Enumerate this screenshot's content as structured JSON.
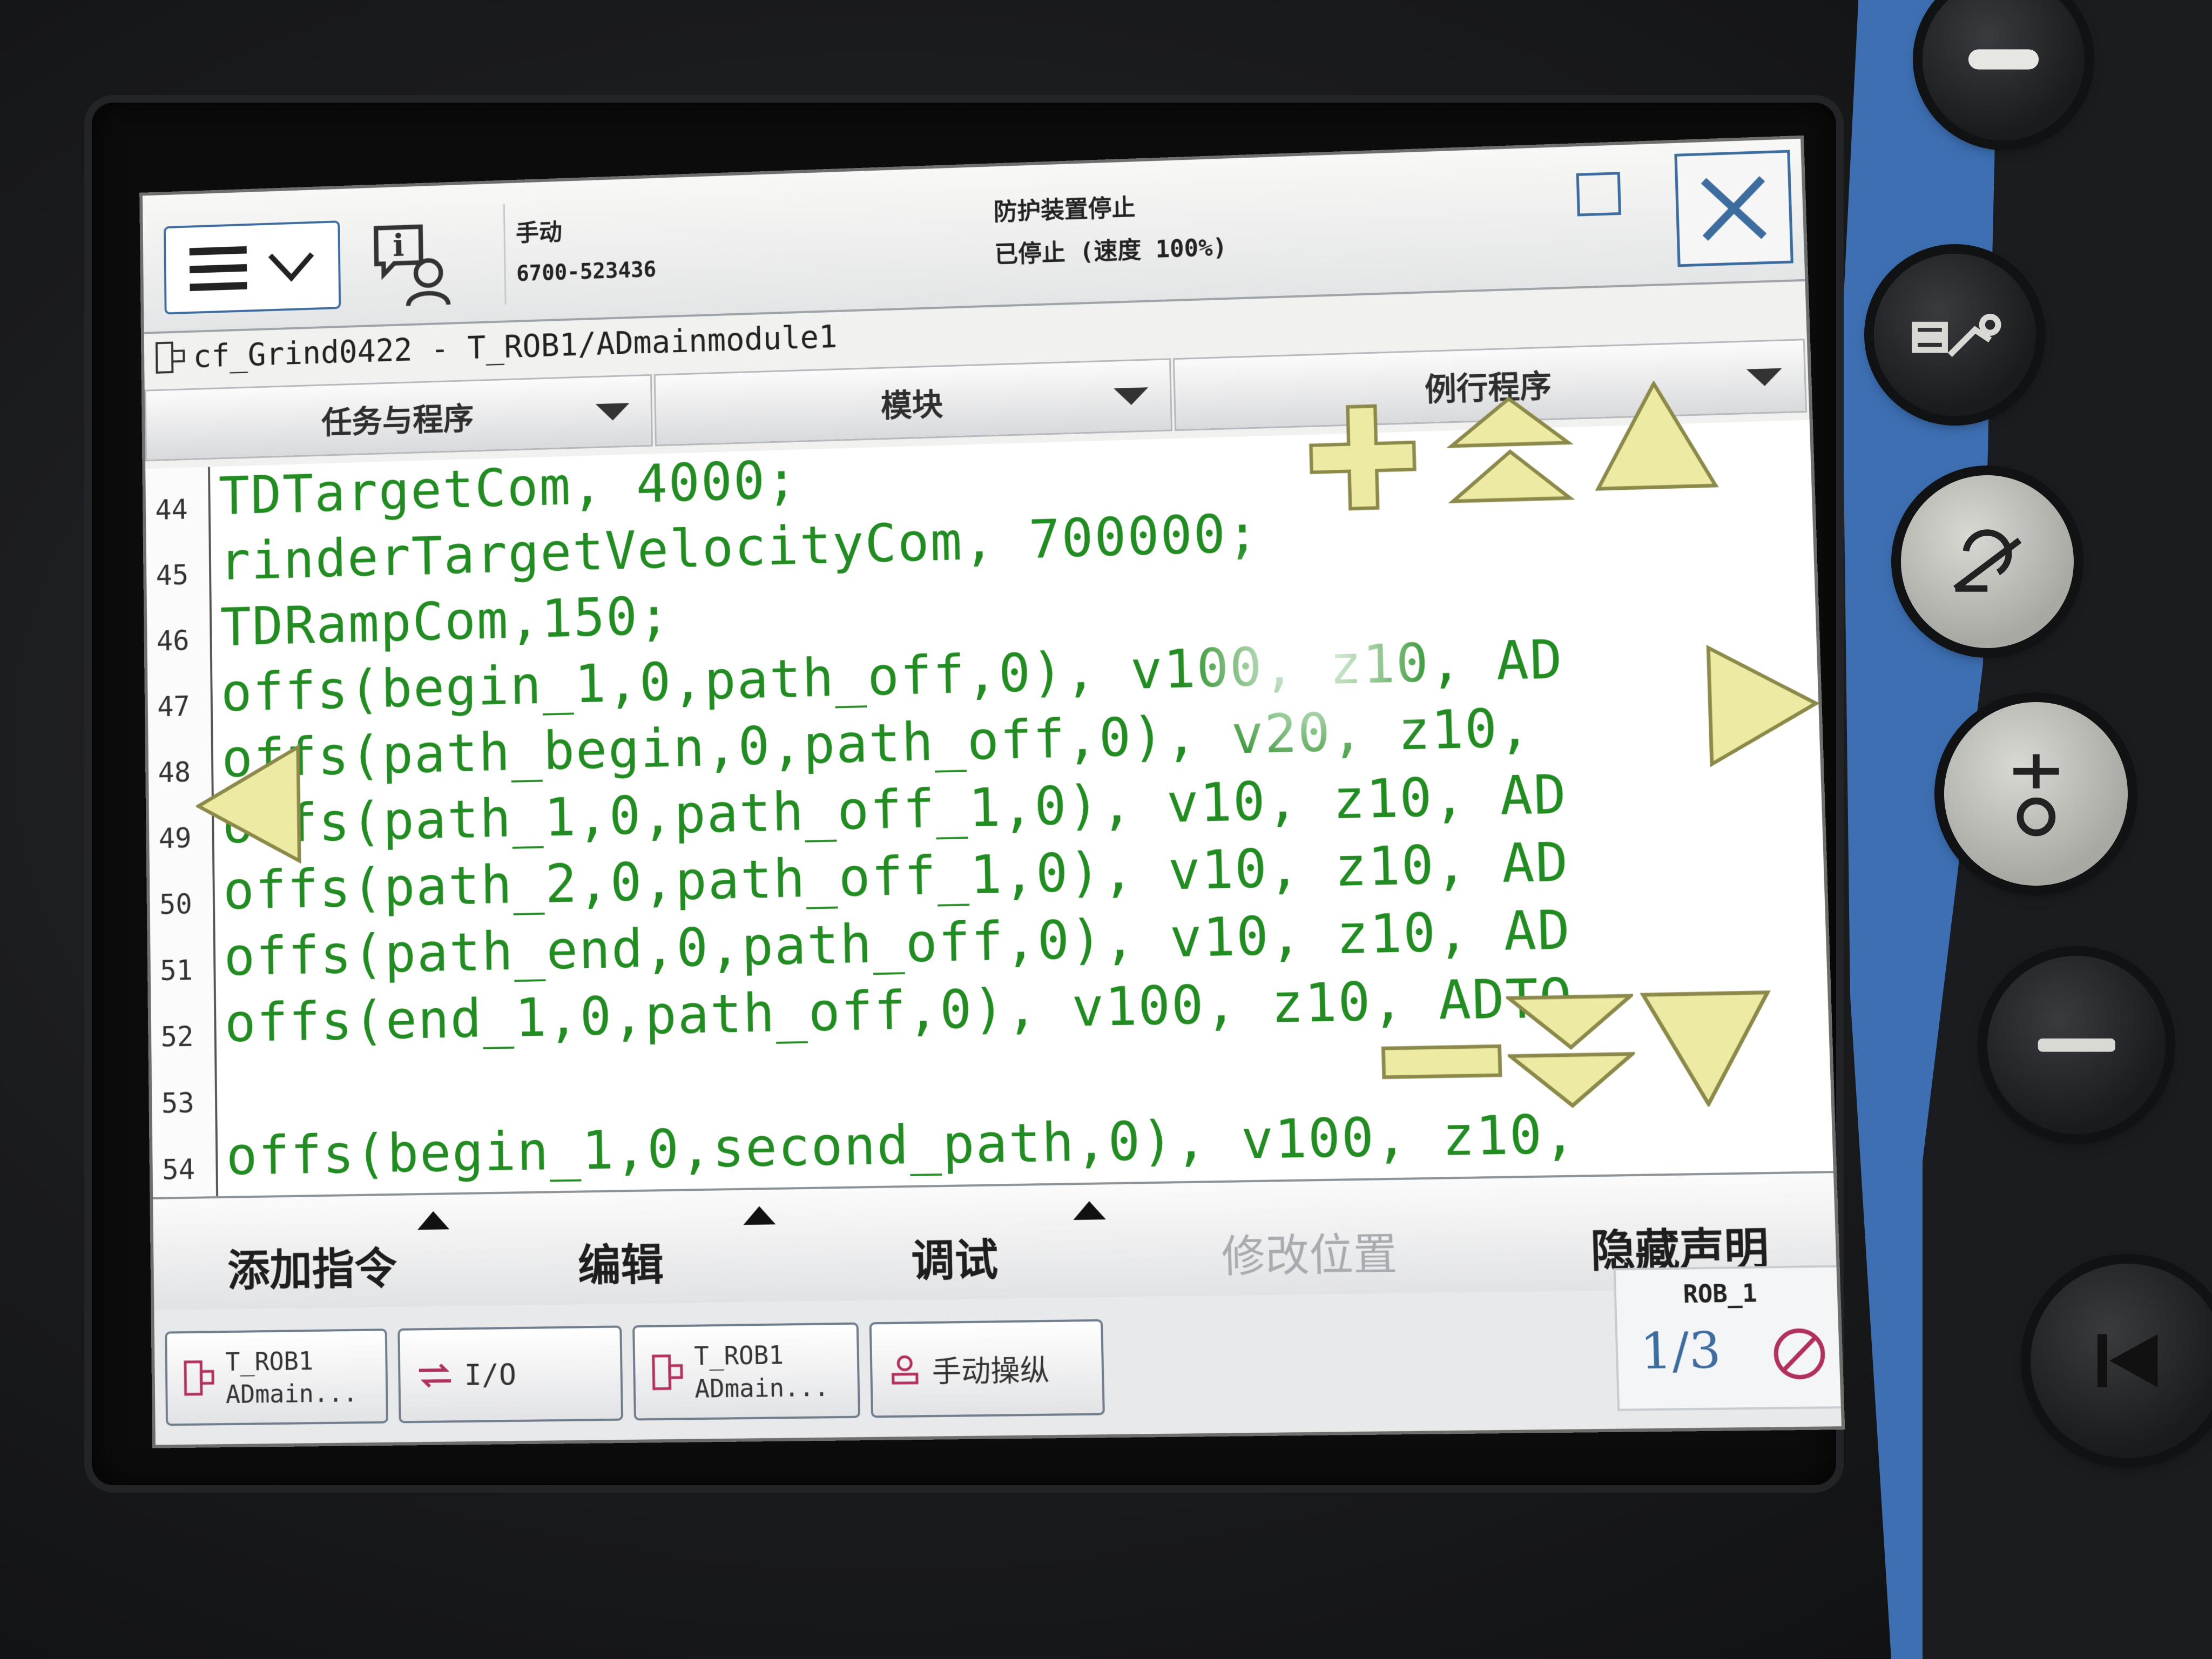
{
  "header": {
    "mode_label": "手动",
    "controller_id": "6700-523436",
    "status_line_1": "防护装置停止",
    "status_line_2": "已停止 (速度 100%)"
  },
  "path": {
    "text": "cf_Grind0422 - T_ROB1/ADmainmodule1"
  },
  "dropdowns": {
    "tasks_label": "任务与程序",
    "modules_label": "模块",
    "routines_label": "例行程序"
  },
  "code_lines": [
    {
      "num": "44",
      "text": "TDTargetCom, 4000;"
    },
    {
      "num": "45",
      "text": "rinderTargetVelocityCom, 700000;"
    },
    {
      "num": "46",
      "text": "TDRampCom,150;"
    },
    {
      "num": "47",
      "text": "offs(begin_1,0,path_off,0), v100, z10, AD"
    },
    {
      "num": "48",
      "text": "offs(path_begin,0,path_off,0), v20, z10,"
    },
    {
      "num": "49",
      "text": "offs(path_1,0,path_off_1,0), v10, z10, AD"
    },
    {
      "num": "50",
      "text": "offs(path_2,0,path_off_1,0), v10, z10, AD"
    },
    {
      "num": "51",
      "text": "offs(path_end,0,path_off,0), v10, z10, AD"
    },
    {
      "num": "52",
      "text": "offs(end_1,0,path_off,0), v100, z10, ADTO"
    },
    {
      "num": "53",
      "text": ""
    },
    {
      "num": "54",
      "text": "offs(begin_1,0,second_path,0), v100, z10,"
    }
  ],
  "commands": {
    "add_instruction": "添加指令",
    "edit": "编辑",
    "debug": "调试",
    "modify_position": "修改位置",
    "hide_declarations": "隐藏声明"
  },
  "taskbar": {
    "task1_line1": "T_ROB1",
    "task1_line2": "ADmain...",
    "io_label": "I/O",
    "task2_line1": "T_ROB1",
    "task2_line2": "ADmain...",
    "jog_label": "手动操纵"
  },
  "robot_status": {
    "unit": "ROB_1",
    "fraction": "1/3"
  },
  "colors": {
    "code_text": "#228b22",
    "nav_arrow_fill": "#eceaa3",
    "frame_blue": "#3d6c9f",
    "device_accent": "#3d6fb2"
  }
}
